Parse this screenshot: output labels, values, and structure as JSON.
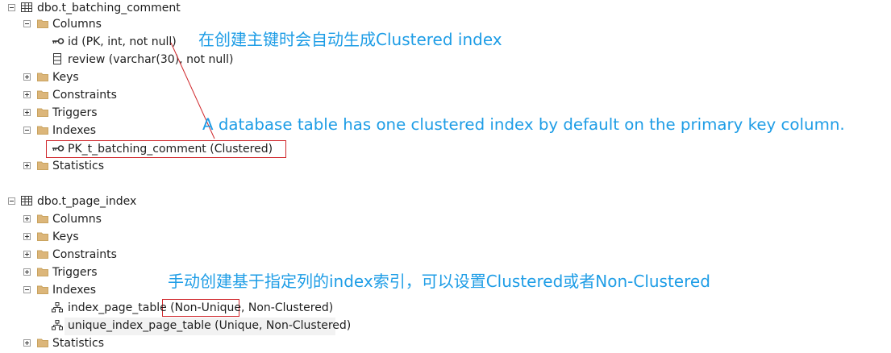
{
  "tree1": {
    "table": "dbo.t_batching_comment",
    "columns_folder": "Columns",
    "column_id": "id (PK, int, not null)",
    "column_review": "review (varchar(30), not null)",
    "keys": "Keys",
    "constraints": "Constraints",
    "triggers": "Triggers",
    "indexes": "Indexes",
    "index_pk": "PK_t_batching_comment (Clustered)",
    "statistics": "Statistics"
  },
  "tree2": {
    "table": "dbo.t_page_index",
    "columns_folder": "Columns",
    "keys": "Keys",
    "constraints": "Constraints",
    "triggers": "Triggers",
    "indexes": "Indexes",
    "index_page_table": "index_page_table (Non-Unique, Non-Clustered)",
    "index_unique": "unique_index_page_table (Unique, Non-Clustered)",
    "statistics": "Statistics"
  },
  "annotations": {
    "pk_clustered_cn": "在创建主键时会自动生成Clustered index",
    "default_clustered_en": "A database table has one clustered index by default on the primary key column.",
    "manual_index_cn": "手动创建基于指定列的index索引，可以设置Clustered或者Non-Clustered"
  },
  "colors": {
    "annotation": "#1e9de6",
    "highlight_box": "#d0282c",
    "folder": "#dcb67a"
  }
}
